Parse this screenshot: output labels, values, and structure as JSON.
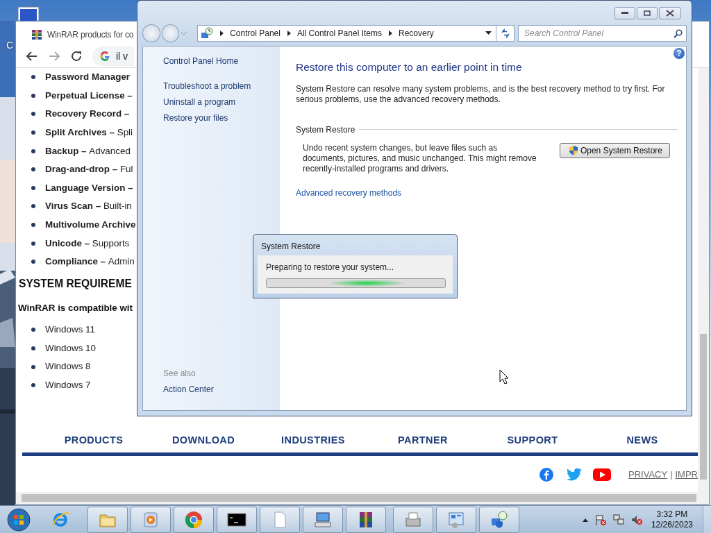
{
  "desktop": {
    "icon_label": "C"
  },
  "browser": {
    "tab_title": "WinRAR products for co",
    "address": "il v",
    "features": [
      {
        "term": "Password Manager"
      },
      {
        "term": "Perpetual License –"
      },
      {
        "term": "Recovery Record –"
      },
      {
        "term": "Split Archives –",
        "desc": "Spli"
      },
      {
        "term": "Backup –",
        "desc": "Advanced"
      },
      {
        "term": "Drag-and-drop –",
        "desc": "Ful"
      },
      {
        "term": "Language Version –"
      },
      {
        "term": "Virus Scan –",
        "desc": "Built-in"
      },
      {
        "term": "Multivolume Archive"
      },
      {
        "term": "Unicode –",
        "desc": "Supports"
      },
      {
        "term": "Compliance –",
        "desc": "Admin"
      }
    ],
    "requirements_heading": "SYSTEM REQUIREME",
    "requirements_intro": "WinRAR is compatible wit",
    "systems": [
      "Windows 11",
      "Windows 10",
      "Windows 8",
      "Windows 7"
    ],
    "footer_nav": [
      "PRODUCTS",
      "DOWNLOAD",
      "INDUSTRIES",
      "PARTNER",
      "SUPPORT",
      "NEWS"
    ],
    "footer_links": [
      "PRIVACY",
      "|",
      "IMPR"
    ]
  },
  "control_panel": {
    "breadcrumb": [
      "Control Panel",
      "All Control Panel Items",
      "Recovery"
    ],
    "search": {
      "placeholder": "Search Control Panel"
    },
    "help": "?",
    "sidebar": {
      "links": [
        "Control Panel Home",
        "Troubleshoot a problem",
        "Uninstall a program",
        "Restore your files"
      ],
      "see_also_heading": "See also",
      "see_also": [
        "Action Center"
      ]
    },
    "heading": "Restore this computer to an earlier point in time",
    "intro": "System Restore can resolve many system problems, and is the best recovery method to try first. For serious problems, use the advanced recovery methods.",
    "section_title": "System Restore",
    "section_text": "Undo recent system changes, but leave files such as documents, pictures, and music unchanged. This might remove recently-installed programs and drivers.",
    "button": "Open System Restore",
    "advanced_link": "Advanced recovery methods"
  },
  "dialog": {
    "title": "System Restore",
    "message": "Preparing to restore your system..."
  },
  "taskbar": {
    "apps": [
      {
        "kind": "ie",
        "running": false
      },
      {
        "kind": "folder",
        "running": true
      },
      {
        "kind": "media",
        "running": true
      },
      {
        "kind": "chrome",
        "running": true
      },
      {
        "kind": "console",
        "running": true
      },
      {
        "kind": "document",
        "running": true
      },
      {
        "kind": "computer",
        "running": true
      },
      {
        "kind": "archive",
        "running": true
      },
      {
        "kind": "fax",
        "running": true
      },
      {
        "kind": "panel",
        "running": true
      },
      {
        "kind": "restore",
        "running": true
      }
    ],
    "time": "3:32 PM",
    "date": "12/26/2023"
  }
}
